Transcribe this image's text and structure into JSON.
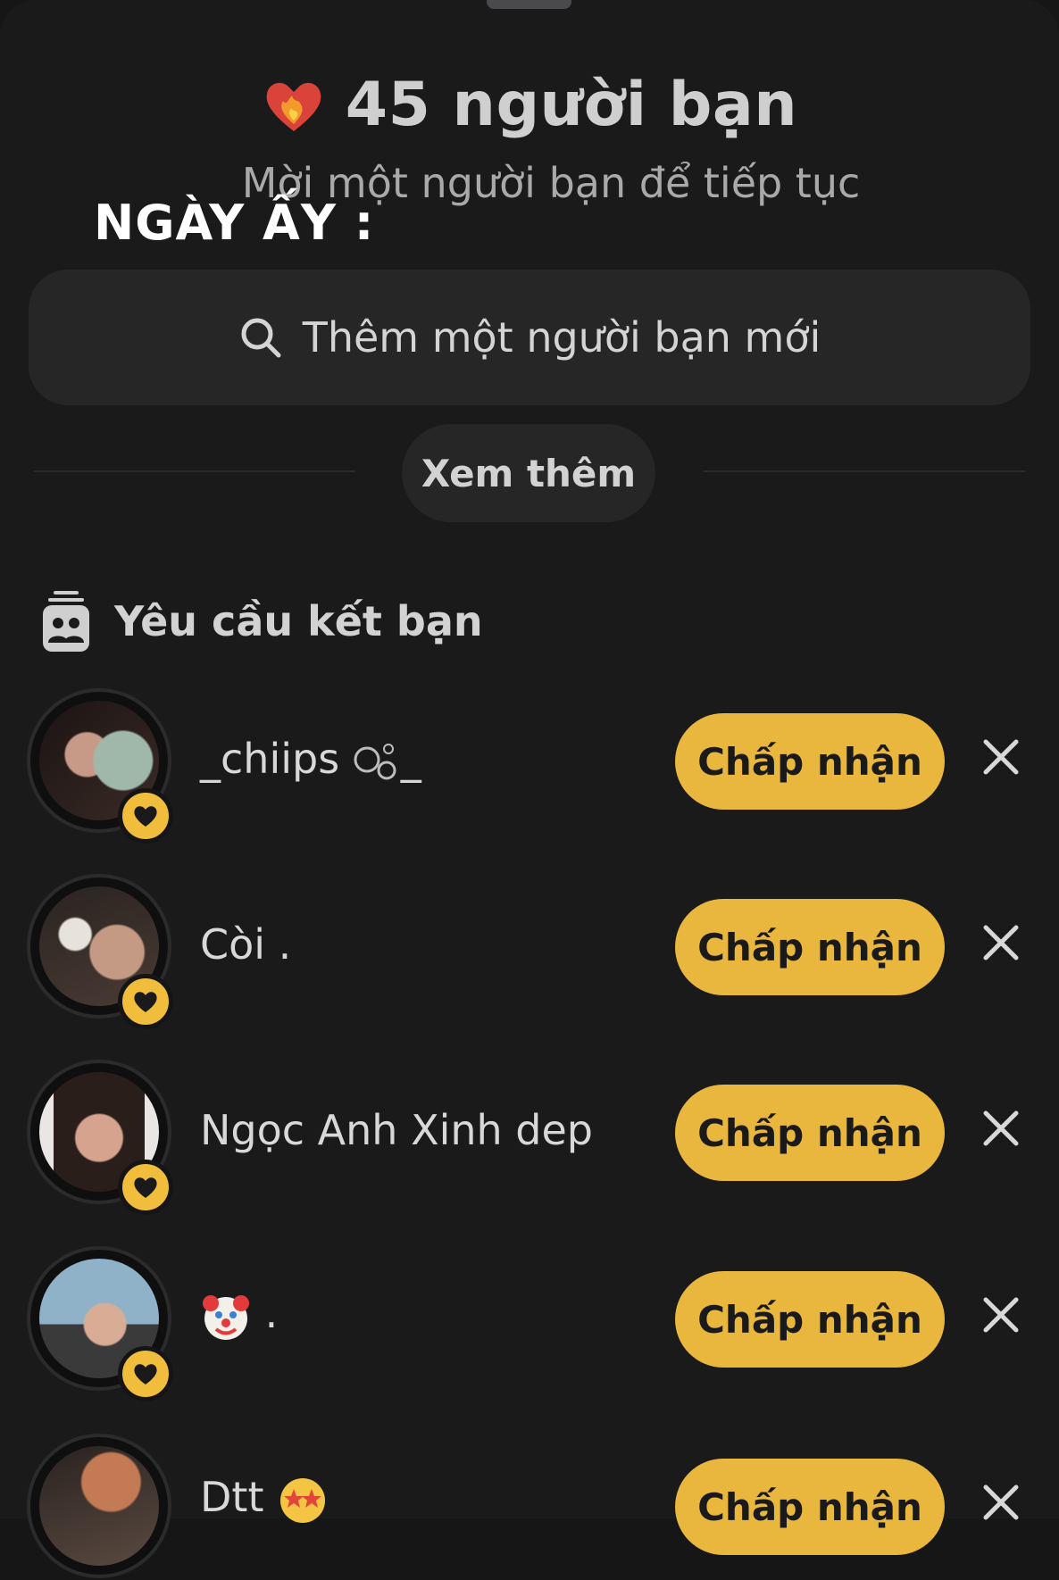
{
  "header": {
    "friends_count_title": "45 người bạn",
    "subtitle": "Mời một người bạn để tiếp tục",
    "overlay_caption": "NGÀY ẤY :"
  },
  "search": {
    "placeholder": "Thêm một người bạn mới"
  },
  "see_more_label": "Xem thêm",
  "section": {
    "title": "Yêu cầu kết bạn"
  },
  "requests": [
    {
      "name": "_chiips",
      "name_suffix": "_",
      "accept_label": "Chấp nhận"
    },
    {
      "name": "Còi .",
      "accept_label": "Chấp nhận"
    },
    {
      "name": "Ngọc Anh Xinh dep",
      "accept_label": "Chấp nhận"
    },
    {
      "name": ".",
      "accept_label": "Chấp nhận"
    },
    {
      "name": "Dtt",
      "accept_label": "Chấp nhận"
    }
  ],
  "colors": {
    "background": "#1a1a1b",
    "accent": "#e9b63e",
    "card": "#262627"
  }
}
